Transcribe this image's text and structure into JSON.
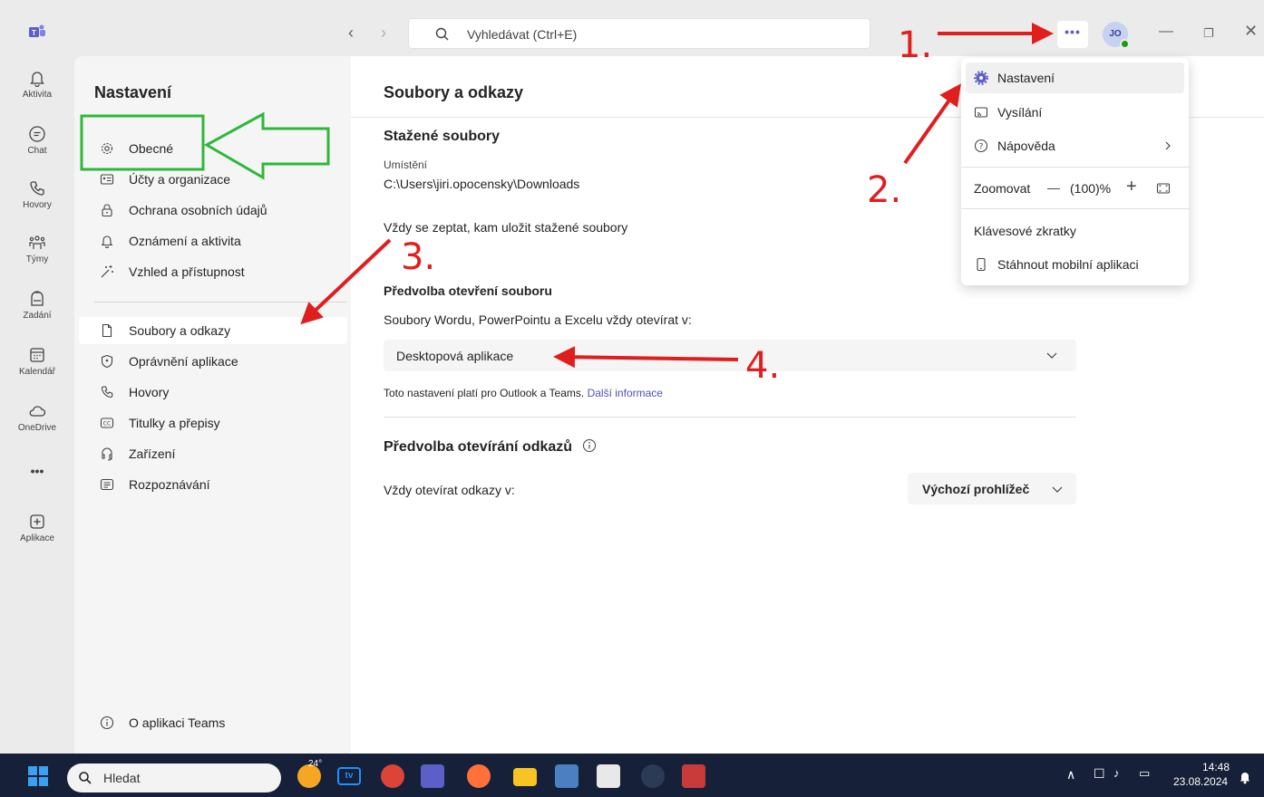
{
  "app": {
    "search_placeholder": "Vyhledávat (Ctrl+E)",
    "more_label": "•••",
    "avatar_initials": "JO"
  },
  "rail": [
    {
      "label": "Aktivita",
      "icon": "bell-icon"
    },
    {
      "label": "Chat",
      "icon": "chat-icon"
    },
    {
      "label": "Hovory",
      "icon": "phone-icon"
    },
    {
      "label": "Týmy",
      "icon": "teams-icon"
    },
    {
      "label": "Zadání",
      "icon": "backpack-icon"
    },
    {
      "label": "Kalendář",
      "icon": "calendar-icon"
    },
    {
      "label": "OneDrive",
      "icon": "cloud-icon"
    },
    {
      "label": "•••",
      "icon": "more-icon"
    },
    {
      "label": "Aplikace",
      "icon": "add-app-icon"
    }
  ],
  "nav": {
    "title": "Nastavení",
    "items": [
      {
        "label": "Obecné",
        "icon": "gear-icon"
      },
      {
        "label": "Účty a organizace",
        "icon": "id-card-icon"
      },
      {
        "label": "Ochrana osobních údajů",
        "icon": "lock-icon"
      },
      {
        "label": "Oznámení a aktivita",
        "icon": "bell-icon"
      },
      {
        "label": "Vzhled a přístupnost",
        "icon": "wand-icon"
      },
      {
        "label": "Soubory a odkazy",
        "icon": "file-icon"
      },
      {
        "label": "Oprávnění aplikace",
        "icon": "shield-icon"
      },
      {
        "label": "Hovory",
        "icon": "phone-icon"
      },
      {
        "label": "Titulky a přepisy",
        "icon": "cc-icon"
      },
      {
        "label": "Zařízení",
        "icon": "headset-icon"
      },
      {
        "label": "Rozpoznávání",
        "icon": "recognition-icon"
      }
    ],
    "about": "O aplikaci Teams"
  },
  "main": {
    "title": "Soubory a odkazy",
    "downloads": {
      "title": "Stažené soubory",
      "location_label": "Umístění",
      "location_value": "C:\\Users\\jiri.opocensky\\Downloads",
      "ask_label": "Vždy se zeptat, kam uložit stažené soubory"
    },
    "file_open": {
      "title": "Předvolba otevření souboru",
      "description": "Soubory Wordu, PowerPointu a Excelu vždy otevírat v:",
      "selected": "Desktopová aplikace",
      "note": "Toto nastavení platí pro Outlook a Teams.",
      "note_link": "Další informace"
    },
    "link_open": {
      "title": "Předvolba otevírání odkazů",
      "description": "Vždy otevírat odkazy v:",
      "selected": "Výchozí prohlížeč"
    }
  },
  "menu": {
    "items": [
      "Nastavení",
      "Vysílání",
      "Nápověda"
    ],
    "zoom_label": "Zoomovat",
    "zoom_value": "(100)%",
    "zoom_minus": "—",
    "zoom_plus": "+",
    "shortcuts": "Klávesové zkratky",
    "mobile": "Stáhnout mobilní aplikaci"
  },
  "annotations": {
    "n1": "1.",
    "n2": "2.",
    "n3": "3.",
    "n4": "4."
  },
  "taskbar": {
    "search": "Hledat",
    "weather": "24°",
    "time": "14:48",
    "date": "23.08.2024"
  },
  "colors": {
    "accent": "#5b5fc7",
    "annotation_red": "#e01e1e",
    "annotation_green": "#2eb83a"
  }
}
